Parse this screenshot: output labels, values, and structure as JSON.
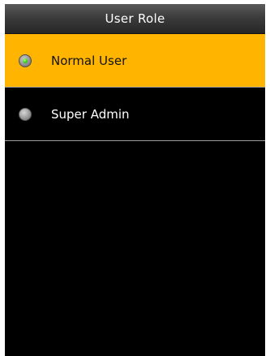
{
  "header": {
    "title": "User Role"
  },
  "options": [
    {
      "label": "Normal User",
      "selected": true
    },
    {
      "label": "Super Admin",
      "selected": false
    }
  ],
  "colors": {
    "selected_background": "#ffb400",
    "screen_background": "#000000",
    "radio_on_dot": "#35c81a",
    "divider": "#9a9a9a"
  },
  "icons": {
    "radio_selected": "radio-selected-icon",
    "radio_unselected": "radio-unselected-icon"
  }
}
